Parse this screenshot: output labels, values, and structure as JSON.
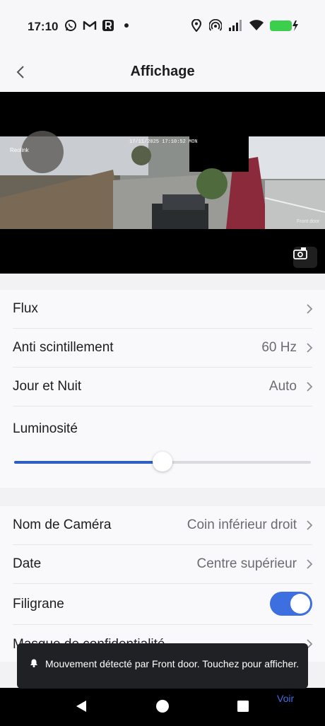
{
  "status_bar": {
    "time": "17:10",
    "notification_icons": [
      "whatsapp-icon",
      "gmail-icon",
      "app-r-icon",
      "dot-icon"
    ],
    "system_icons": [
      "location-icon",
      "hotspot-icon",
      "signal-icon",
      "wifi-icon",
      "battery-charging-icon"
    ],
    "battery_color": "#3ccf4e"
  },
  "header": {
    "title": "Affichage",
    "back_icon": "chevron-left-icon"
  },
  "video": {
    "timestamp": "17/11/2025 17:10:52 MON",
    "watermark": "Reolink",
    "camera_name": "Front door",
    "snapshot_icon": "camera-snapshot-icon"
  },
  "settings_group1": [
    {
      "label": "Flux",
      "value": ""
    },
    {
      "label": "Anti scintillement",
      "value": "60 Hz"
    },
    {
      "label": "Jour et Nuit",
      "value": "Auto"
    }
  ],
  "brightness": {
    "label": "Luminosité",
    "level": 0.5,
    "accent": "#2f5fc4"
  },
  "settings_group2": [
    {
      "label": "Nom de Caméra",
      "value": "Coin inférieur droit"
    },
    {
      "label": "Date",
      "value": "Centre supérieur"
    },
    {
      "label": "Filigrane",
      "toggle": true
    },
    {
      "label": "Masque de confidentialité"
    }
  ],
  "toast": {
    "message": "Mouvement détecté par Front door. Touchez pour afficher.",
    "action": "Voir",
    "icon": "bell-icon"
  },
  "system_nav": [
    "back-triangle-icon",
    "home-circle-icon",
    "recents-square-icon"
  ]
}
